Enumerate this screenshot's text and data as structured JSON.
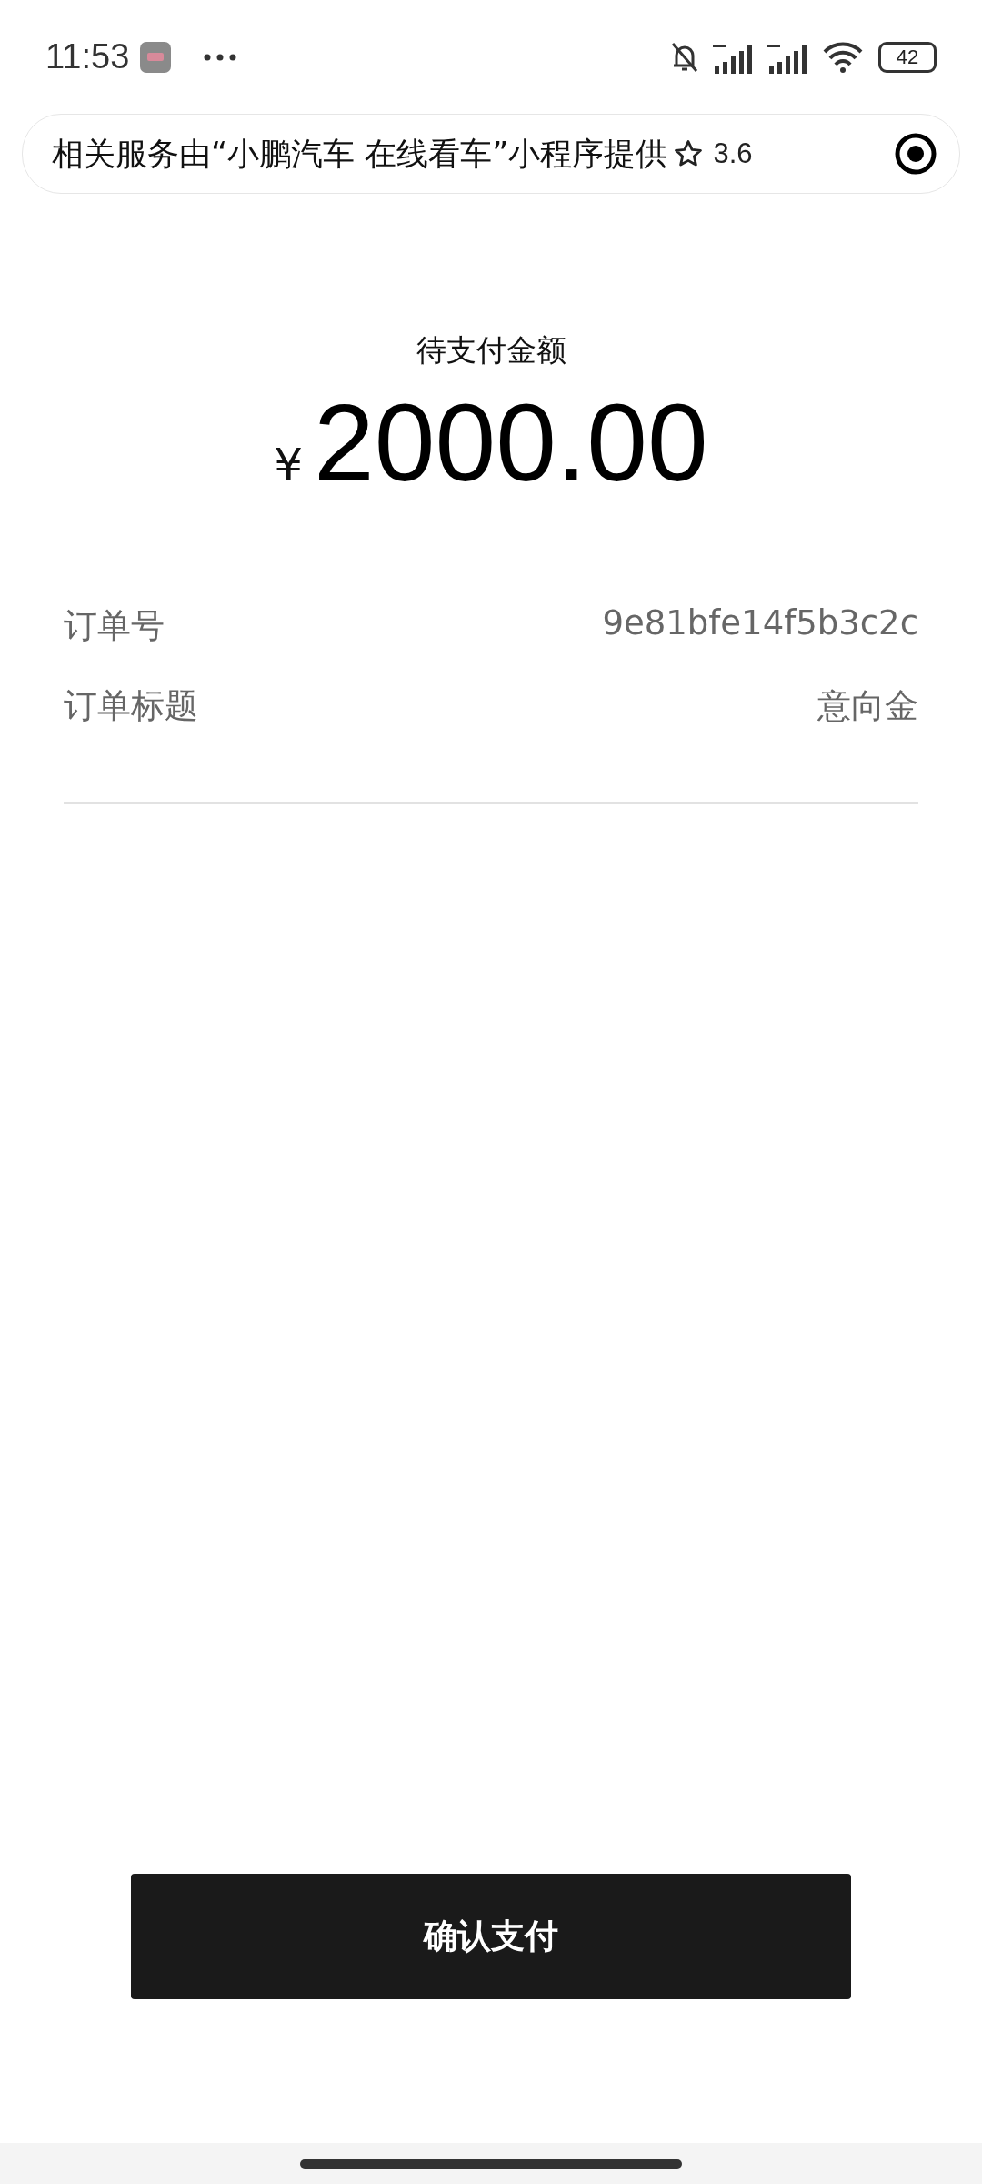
{
  "status_bar": {
    "time": "11:53",
    "battery": "42"
  },
  "header": {
    "notice": "相关服务由“小鹏汽车 在线看车”小程序提供",
    "rating": "3.6"
  },
  "payment": {
    "label": "待支付金额",
    "currency": "¥",
    "amount": "2000.00"
  },
  "details": [
    {
      "label": "订单号",
      "value": "9e81bfe14f5b3c2c"
    },
    {
      "label": "订单标题",
      "value": "意向金"
    }
  ],
  "confirm_button": "确认支付"
}
